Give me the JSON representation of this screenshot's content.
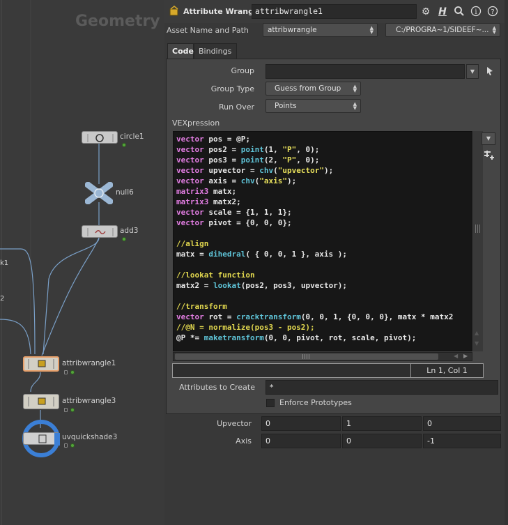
{
  "network": {
    "title": "Geometry",
    "nodes": [
      {
        "name": "circle1"
      },
      {
        "name": "null6"
      },
      {
        "name": "add3"
      },
      {
        "name": "attribwrangle1"
      },
      {
        "name": "attribwrangle3"
      },
      {
        "name": "uvquickshade3"
      }
    ],
    "offscreen_labels": [
      "k1",
      "2"
    ]
  },
  "header": {
    "node_type": "Attribute Wrangle",
    "node_name": "attribwrangle1",
    "icons": [
      "gear-icon",
      "help-h-icon",
      "search-icon",
      "info-icon",
      "question-icon"
    ]
  },
  "asset": {
    "label": "Asset Name and Path",
    "name_value": "attribwrangle",
    "path_value": "C:/PROGRA~1/SIDEEF~..."
  },
  "tabs": [
    {
      "label": "Code",
      "active": true
    },
    {
      "label": "Bindings",
      "active": false
    }
  ],
  "code_tab": {
    "group_label": "Group",
    "group_value": "",
    "group_type_label": "Group Type",
    "group_type_value": "Guess from Group",
    "run_over_label": "Run Over",
    "run_over_value": "Points",
    "vexpression_label": "VEXpression",
    "cursor_position": "Ln 1, Col 1",
    "attributes_label": "Attributes to Create",
    "attributes_value": "*",
    "enforce_label": "Enforce Prototypes",
    "enforce_checked": false
  },
  "code_lines": [
    [
      [
        "kw",
        "vector"
      ],
      [
        "t",
        " pos = @P;"
      ]
    ],
    [
      [
        "kw",
        "vector"
      ],
      [
        "t",
        " pos2 = "
      ],
      [
        "fn",
        "point"
      ],
      [
        "t",
        "(1, "
      ],
      [
        "str",
        "\"P\""
      ],
      [
        "t",
        ", 0);"
      ]
    ],
    [
      [
        "kw",
        "vector"
      ],
      [
        "t",
        " pos3 = "
      ],
      [
        "fn",
        "point"
      ],
      [
        "t",
        "(2, "
      ],
      [
        "str",
        "\"P\""
      ],
      [
        "t",
        ", 0);"
      ]
    ],
    [
      [
        "kw",
        "vector"
      ],
      [
        "t",
        " upvector = "
      ],
      [
        "fn",
        "chv"
      ],
      [
        "t",
        "("
      ],
      [
        "str",
        "\"upvector\""
      ],
      [
        "t",
        ");"
      ]
    ],
    [
      [
        "kw",
        "vector"
      ],
      [
        "t",
        " axis = "
      ],
      [
        "fn",
        "chv"
      ],
      [
        "t",
        "("
      ],
      [
        "str",
        "\"axis\""
      ],
      [
        "t",
        ");"
      ]
    ],
    [
      [
        "kw",
        "matrix3"
      ],
      [
        "t",
        " matx;"
      ]
    ],
    [
      [
        "kw",
        "matrix3"
      ],
      [
        "t",
        " matx2;"
      ]
    ],
    [
      [
        "kw",
        "vector"
      ],
      [
        "t",
        " scale = {1, 1, 1};"
      ]
    ],
    [
      [
        "kw",
        "vector"
      ],
      [
        "t",
        " pivot = {0, 0, 0};"
      ]
    ],
    [
      [
        "t",
        ""
      ]
    ],
    [
      [
        "cm",
        "//align"
      ]
    ],
    [
      [
        "t",
        "matx = "
      ],
      [
        "fn",
        "dihedral"
      ],
      [
        "t",
        "( { 0, 0, 1 }, axis );"
      ]
    ],
    [
      [
        "t",
        ""
      ]
    ],
    [
      [
        "cm",
        "//lookat function"
      ]
    ],
    [
      [
        "t",
        "matx2 = "
      ],
      [
        "fn",
        "lookat"
      ],
      [
        "t",
        "(pos2, pos3, upvector);"
      ]
    ],
    [
      [
        "t",
        ""
      ]
    ],
    [
      [
        "cm",
        "//transform"
      ]
    ],
    [
      [
        "kw",
        "vector"
      ],
      [
        "t",
        " rot = "
      ],
      [
        "fn",
        "cracktransform"
      ],
      [
        "t",
        "(0, 0, 1, {0, 0, 0}, matx * matx2"
      ]
    ],
    [
      [
        "cm",
        "//@N = normalize(pos3 - pos2);"
      ]
    ],
    [
      [
        "t",
        "@P *= "
      ],
      [
        "fn",
        "maketransform"
      ],
      [
        "t",
        "(0, 0, pivot, rot, scale, pivot);"
      ]
    ]
  ],
  "spare_params": {
    "upvector_label": "Upvector",
    "upvector": [
      "0",
      "1",
      "0"
    ],
    "axis_label": "Axis",
    "axis": [
      "0",
      "0",
      "-1"
    ]
  },
  "colors": {
    "keyword": "#e47ee4",
    "function": "#5fc4d8",
    "string": "#e8e05c",
    "comment": "#e3d94f",
    "selected_node_ring": "#3b7fd6"
  }
}
